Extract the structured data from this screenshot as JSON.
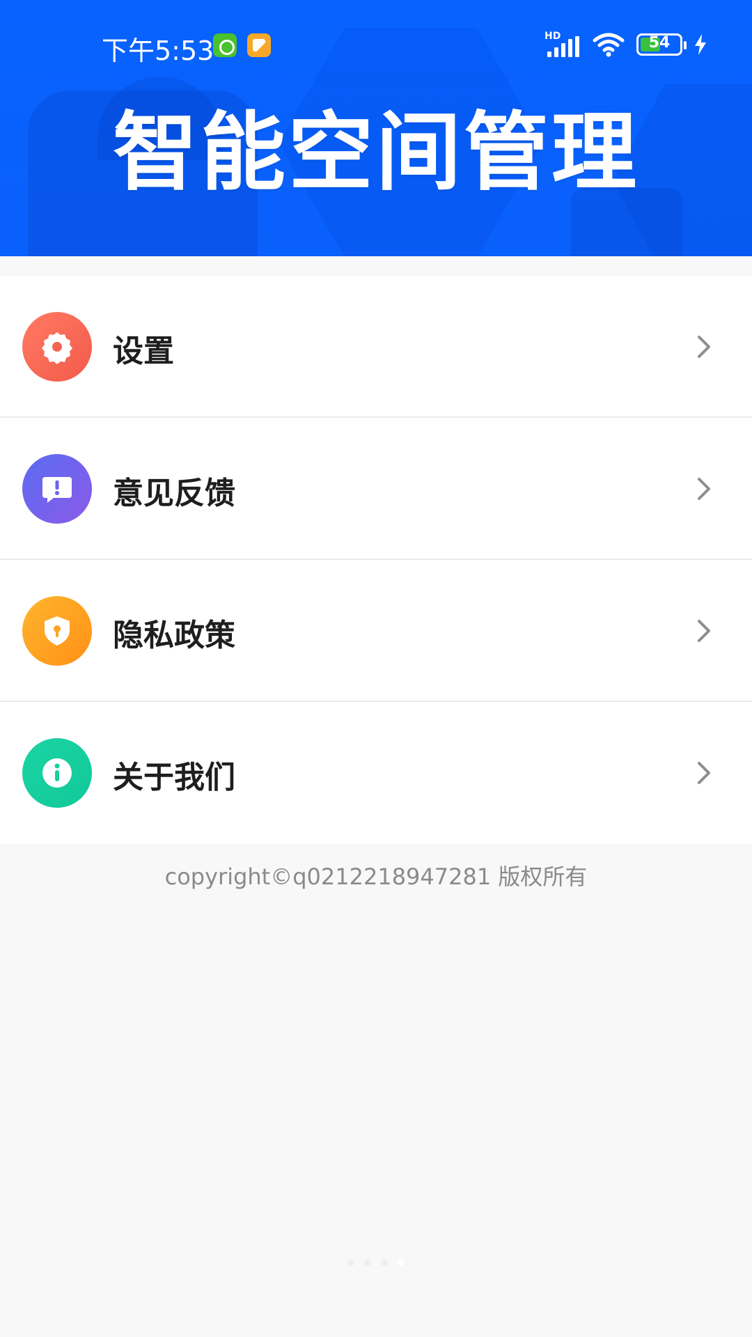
{
  "status_bar": {
    "time": "下午5:53",
    "network_label": "HD",
    "battery_level": "54",
    "battery_color": "#39c03d"
  },
  "banner": {
    "title": "智能空间管理",
    "background_color": "#0862ff"
  },
  "menu": {
    "items": [
      {
        "label": "设置",
        "icon": "gear-icon",
        "color": "#f46350"
      },
      {
        "label": "意见反馈",
        "icon": "feedback-icon",
        "color": "#6e63ee"
      },
      {
        "label": "隐私政策",
        "icon": "shield-lock-icon",
        "color": "#ffa321"
      },
      {
        "label": "关于我们",
        "icon": "info-icon",
        "color": "#16cf9e"
      }
    ]
  },
  "footer": {
    "copyright": "copyright©q0212218947281 版权所有"
  },
  "pager": {
    "total": 4,
    "active_index": 3
  }
}
